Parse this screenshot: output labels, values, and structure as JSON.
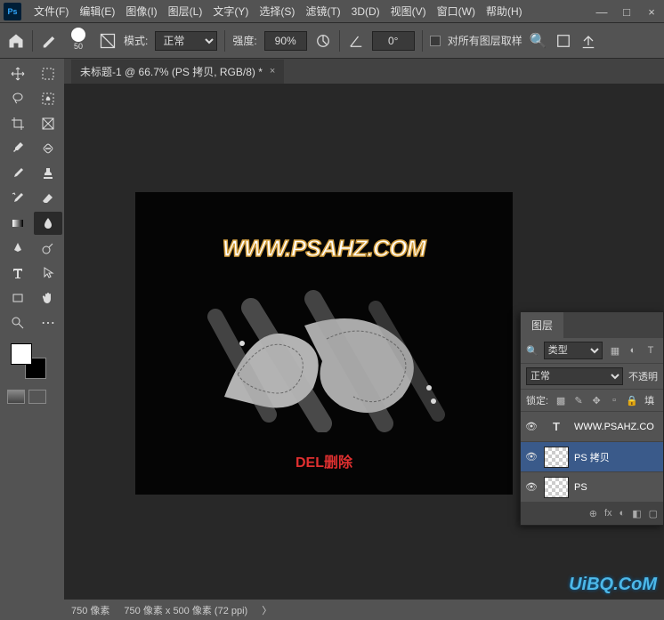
{
  "menubar": {
    "items": [
      "文件(F)",
      "编辑(E)",
      "图像(I)",
      "图层(L)",
      "文字(Y)",
      "选择(S)",
      "滤镜(T)",
      "3D(D)",
      "视图(V)",
      "窗口(W)",
      "帮助(H)"
    ]
  },
  "window_controls": {
    "min": "—",
    "max": "□",
    "close": "×"
  },
  "options": {
    "brush_size": "50",
    "mode_label": "模式:",
    "mode_value": "正常",
    "strength_label": "强度:",
    "strength_value": "90%",
    "angle_value": "0°",
    "sample_all_label": "对所有图层取样"
  },
  "document": {
    "tab_title": "未标题-1 @ 66.7% (PS 拷贝, RGB/8) *"
  },
  "canvas": {
    "watermark": "WWW.PSAHZ.COM",
    "del_text": "DEL删除"
  },
  "uibq": "UiBQ.CoM",
  "layers_panel": {
    "tab": "图层",
    "filter_label": "类型",
    "blend_mode": "正常",
    "opacity_label": "不透明",
    "lock_label": "锁定:",
    "fill_label": "填",
    "layers": [
      {
        "type": "T",
        "name": "WWW.PSAHZ.CO"
      },
      {
        "type": "img",
        "name": "PS 拷贝",
        "selected": true
      },
      {
        "type": "img",
        "name": "PS"
      }
    ],
    "footer_icons": [
      "⊕",
      "fx",
      "◐",
      "◧",
      "▢"
    ]
  },
  "statusbar": {
    "zoom": "750 像素",
    "dims": "750 像素 x 500 像素 (72 ppi)"
  },
  "icons": {
    "search": "🔍",
    "eye": "👁"
  }
}
